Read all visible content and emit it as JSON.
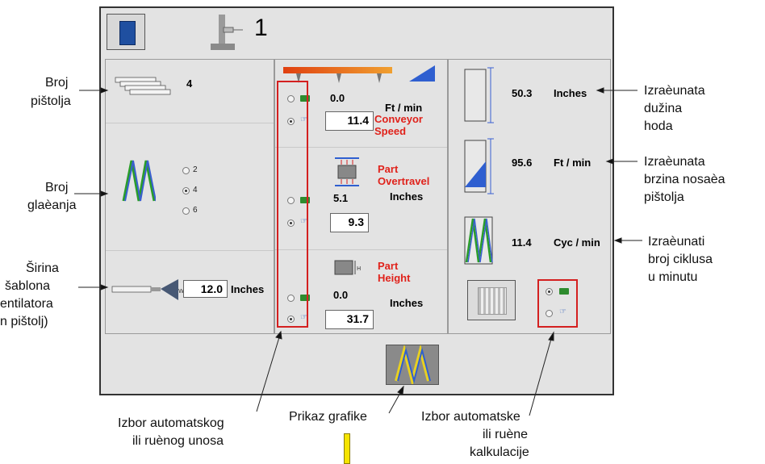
{
  "header": {
    "station_number": "1"
  },
  "left": {
    "guns_count": "4",
    "pass_options": [
      "2",
      "4",
      "6"
    ],
    "pattern_width_value": "12.0",
    "pattern_width_unit": "Inches"
  },
  "middle": {
    "conveyor_auto_value": "0.0",
    "conveyor_unit": "Ft / min",
    "conveyor_manual_value": "11.4",
    "conveyor_label_1": "Conveyor",
    "conveyor_label_2": "Speed",
    "overtravel_label_1": "Part",
    "overtravel_label_2": "Overtravel",
    "overtravel_auto_value": "5.1",
    "overtravel_unit": "Inches",
    "overtravel_manual_value": "9.3",
    "height_label_1": "Part",
    "height_label_2": "Height",
    "height_auto_value": "0.0",
    "height_unit": "Inches",
    "height_manual_value": "31.7"
  },
  "right": {
    "stroke_value": "50.3",
    "stroke_unit": "Inches",
    "carriage_speed_value": "95.6",
    "carriage_speed_unit": "Ft / min",
    "cycles_value": "11.4",
    "cycles_unit": "Cyc / min"
  },
  "annotations": {
    "guns_l1": "Broj",
    "guns_l2": "pištolja",
    "passes_l1": "Broj",
    "passes_l2": "glaèanja",
    "width_l1": "Širina",
    "width_l2": "šablona",
    "width_l3": "entilatora",
    "width_l4": "n pištolj)",
    "stroke_l1": "Izraèunata",
    "stroke_l2": "dužina",
    "stroke_l3": "hoda",
    "speed_l1": "Izraèunata",
    "speed_l2": "brzina nosaèa",
    "speed_l3": "pištolja",
    "cycles_l1": "Izraèunati",
    "cycles_l2": "broj ciklusa",
    "cycles_l3": "u minutu",
    "input_l1": "Izbor automatskog",
    "input_l2": "ili ruènog unosa",
    "graphics_l1": "Prikaz grafike",
    "calc_l1": "Izbor automatske",
    "calc_l2": "ili ruène",
    "calc_l3": "kalkulacije"
  }
}
